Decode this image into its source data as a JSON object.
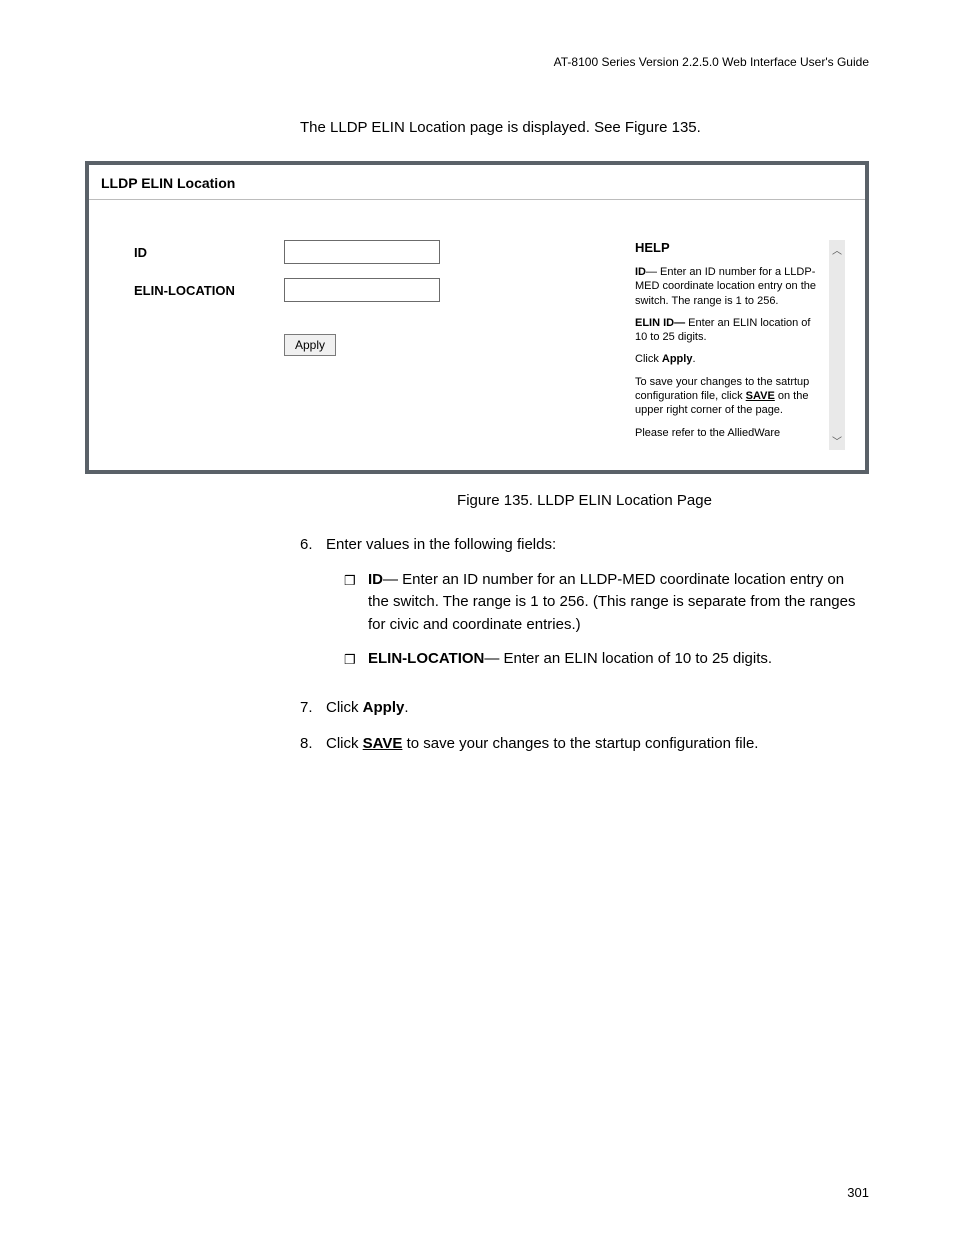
{
  "header": "AT-8100 Series Version 2.2.5.0 Web Interface User's Guide",
  "intro": "The LLDP ELIN Location page is displayed. See Figure 135.",
  "panel": {
    "title": "LLDP ELIN Location",
    "id_label": "ID",
    "elin_label": "ELIN-LOCATION",
    "apply": "Apply"
  },
  "help": {
    "title": "HELP",
    "p1_prefix": "ID",
    "p1_rest": "— Enter an ID number for a LLDP-MED coordinate location entry on the switch. The range is 1 to 256.",
    "p2_prefix": "ELIN ID—",
    "p2_rest": " Enter an ELIN location of 10 to 25 digits.",
    "p3_pre": "Click ",
    "p3_bold": "Apply",
    "p3_post": ".",
    "p4_pre": "To save your changes to the satrtup configuration file, click ",
    "p4_link": "SAVE",
    "p4_post": " on the upper right corner of the page.",
    "p5": "Please refer to the AlliedWare"
  },
  "caption": "Figure 135. LLDP ELIN Location Page",
  "steps": {
    "s6_num": "6.",
    "s6_text": "Enter values in the following fields:",
    "b1_bold": "ID",
    "b1_text": "— Enter an ID number for an LLDP-MED coordinate location entry on the switch. The range is 1 to 256. (This range is separate from the ranges for civic and coordinate entries.)",
    "b2_bold": "ELIN-LOCATION",
    "b2_text": "— Enter an ELIN location of 10 to 25 digits.",
    "s7_num": "7.",
    "s7_pre": "Click ",
    "s7_bold": "Apply",
    "s7_post": ".",
    "s8_num": "8.",
    "s8_pre": "Click ",
    "s8_link": "SAVE",
    "s8_post": " to save your changes to the startup configuration file."
  },
  "page_number": "301"
}
